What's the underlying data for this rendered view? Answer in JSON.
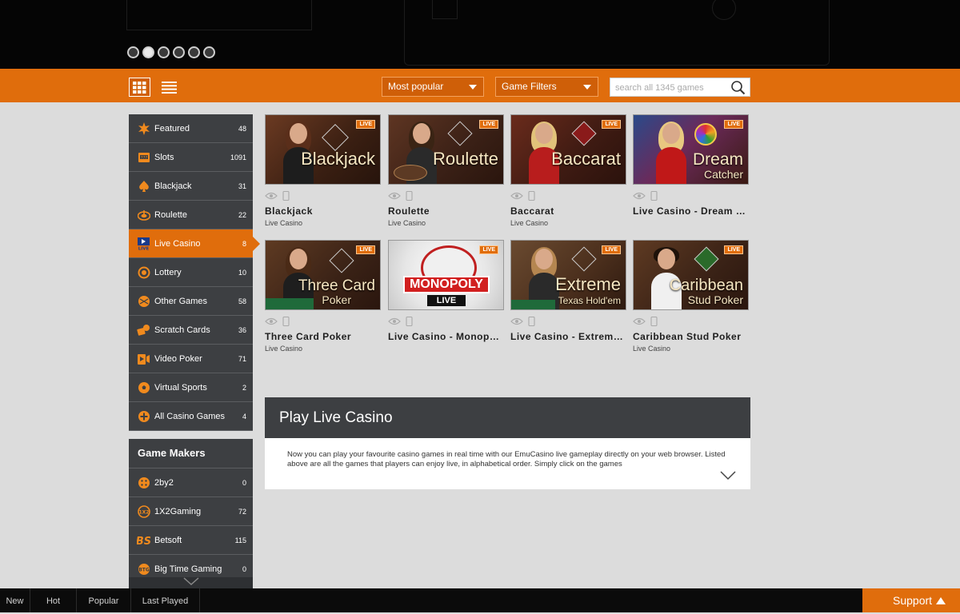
{
  "carousel": {
    "dots": 6,
    "active_dot": 1
  },
  "toolbar": {
    "sort": {
      "selected": "Most popular"
    },
    "filters": {
      "label": "Game Filters"
    },
    "search": {
      "placeholder": "search all 1345 games"
    }
  },
  "sidebar": {
    "items": [
      {
        "label": "Featured",
        "count": "48",
        "icon": "star-burst-icon"
      },
      {
        "label": "Slots",
        "count": "1091",
        "icon": "slot-machine-icon"
      },
      {
        "label": "Blackjack",
        "count": "31",
        "icon": "spade-icon"
      },
      {
        "label": "Roulette",
        "count": "22",
        "icon": "roulette-wheel-icon"
      },
      {
        "label": "Live Casino",
        "count": "8",
        "icon": "live-tv-icon",
        "active": true
      },
      {
        "label": "Lottery",
        "count": "10",
        "icon": "lottery-ball-icon"
      },
      {
        "label": "Other Games",
        "count": "58",
        "icon": "other-games-icon"
      },
      {
        "label": "Scratch Cards",
        "count": "36",
        "icon": "scratch-card-icon"
      },
      {
        "label": "Video Poker",
        "count": "71",
        "icon": "video-poker-icon"
      },
      {
        "label": "Virtual Sports",
        "count": "2",
        "icon": "soccer-ball-icon"
      },
      {
        "label": "All Casino Games",
        "count": "4",
        "icon": "plus-circle-icon"
      }
    ]
  },
  "makers": {
    "title": "Game Makers",
    "items": [
      {
        "label": "2by2",
        "count": "0"
      },
      {
        "label": "1X2Gaming",
        "count": "72"
      },
      {
        "label": "Betsoft",
        "count": "115"
      },
      {
        "label": "Big Time Gaming",
        "count": "0"
      }
    ]
  },
  "games": [
    {
      "name": "Blackjack",
      "category": "Live Casino",
      "badge": "LIVE",
      "art_title": "Blackjack",
      "art_sub": ""
    },
    {
      "name": "Roulette",
      "category": "Live Casino",
      "badge": "LIVE",
      "art_title": "Roulette",
      "art_sub": ""
    },
    {
      "name": "Baccarat",
      "category": "Live Casino",
      "badge": "LIVE",
      "art_title": "Baccarat",
      "art_sub": ""
    },
    {
      "name": "Live Casino - Dream C…",
      "category": "",
      "badge": "LIVE",
      "art_title": "Dream",
      "art_sub": "Catcher"
    },
    {
      "name": "Three Card Poker",
      "category": "Live Casino",
      "badge": "LIVE",
      "art_title": "Three Card",
      "art_sub": "Poker"
    },
    {
      "name": "Live Casino - Monopoly",
      "category": "",
      "badge": "LIVE",
      "art_title": "MONOPOLY",
      "art_sub": "LIVE"
    },
    {
      "name": "Live Casino - Extreme…",
      "category": "",
      "badge": "LIVE",
      "art_title": "Extreme",
      "art_sub": "Texas Hold'em"
    },
    {
      "name": "Caribbean Stud Poker",
      "category": "Live Casino",
      "badge": "LIVE",
      "art_title": "Caribbean",
      "art_sub": "Stud Poker"
    }
  ],
  "info": {
    "title": "Play Live Casino",
    "text": "Now you can play your favourite casino games in real time with our EmuCasino live gameplay directly on your web browser. Listed above are all the games that players can enjoy live, in alphabetical order. Simply click on the games"
  },
  "bottom": {
    "tabs": [
      "New",
      "Hot",
      "Popular",
      "Last Played"
    ],
    "support": "Support"
  },
  "colors": {
    "accent": "#e06d0c",
    "panel": "#3d3f42",
    "background": "#dcdcdc"
  }
}
